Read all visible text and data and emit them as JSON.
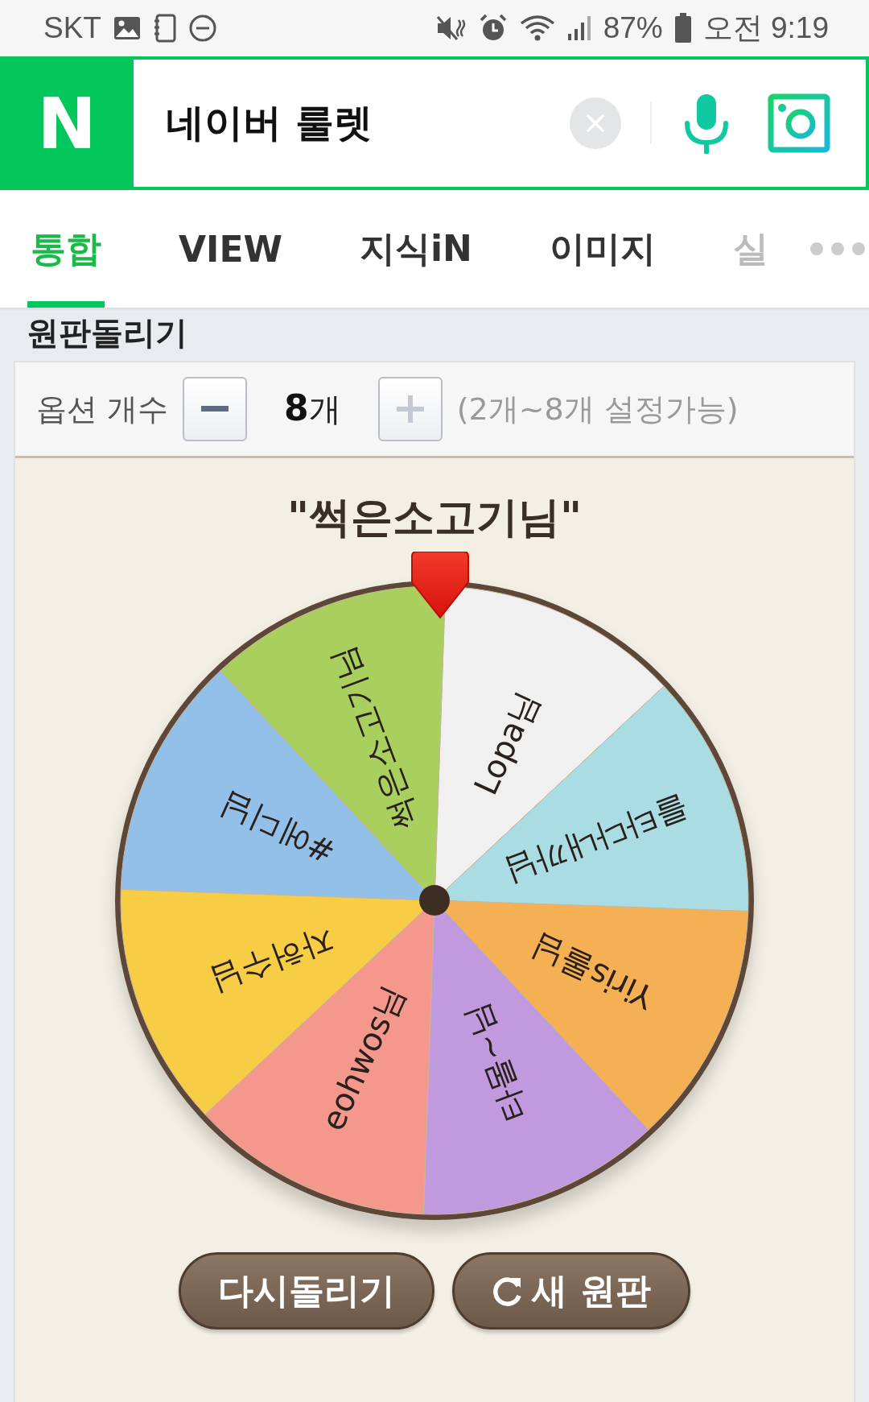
{
  "status_bar": {
    "carrier": "SKT",
    "battery": "87%",
    "time": "오전 9:19"
  },
  "search": {
    "logo": "N",
    "query": "네이버 룰렛"
  },
  "tabs": [
    {
      "label": "통합",
      "selected": true
    },
    {
      "label": "VIEW",
      "selected": false
    },
    {
      "label": "지식iN",
      "selected": false
    },
    {
      "label": "이미지",
      "selected": false
    },
    {
      "label": "실",
      "selected": false
    }
  ],
  "section_title": "원판돌리기",
  "options": {
    "label": "옵션 개수",
    "count_value": "8",
    "count_unit": "개",
    "range_hint": "(2개~8개 설정가능)"
  },
  "wheel": {
    "title": "\"썩은소고기님\"",
    "segments": [
      {
        "label": "Lopa님",
        "color": "#f0f0f0"
      },
      {
        "label": "를타다내까님",
        "color": "#a9dce3"
      },
      {
        "label": "Yiris롤님",
        "color": "#f6b054"
      },
      {
        "label": "타몰~님",
        "color": "#c199df"
      },
      {
        "label": "eohwos님",
        "color": "#f4988e"
      },
      {
        "label": "자허수님",
        "color": "#f8cd46"
      },
      {
        "label": "#에디님",
        "color": "#92c0e9"
      },
      {
        "label": "썩은소고기님",
        "color": "#a9cf5e"
      }
    ]
  },
  "buttons": [
    {
      "kind": "spin",
      "label": "다시돌리기"
    },
    {
      "kind": "reset",
      "label": "새 원판"
    }
  ]
}
